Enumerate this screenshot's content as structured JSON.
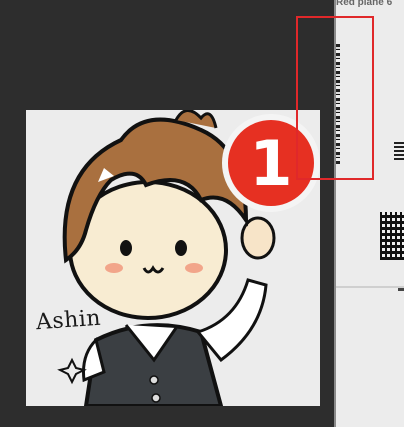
{
  "right_panel": {
    "title": "Red plane 6"
  },
  "artwork": {
    "signature": "Ashin",
    "badge_number": "1"
  },
  "colors": {
    "badge": "#e63022",
    "selection": "#e0282a",
    "background": "#2d2d2d"
  }
}
